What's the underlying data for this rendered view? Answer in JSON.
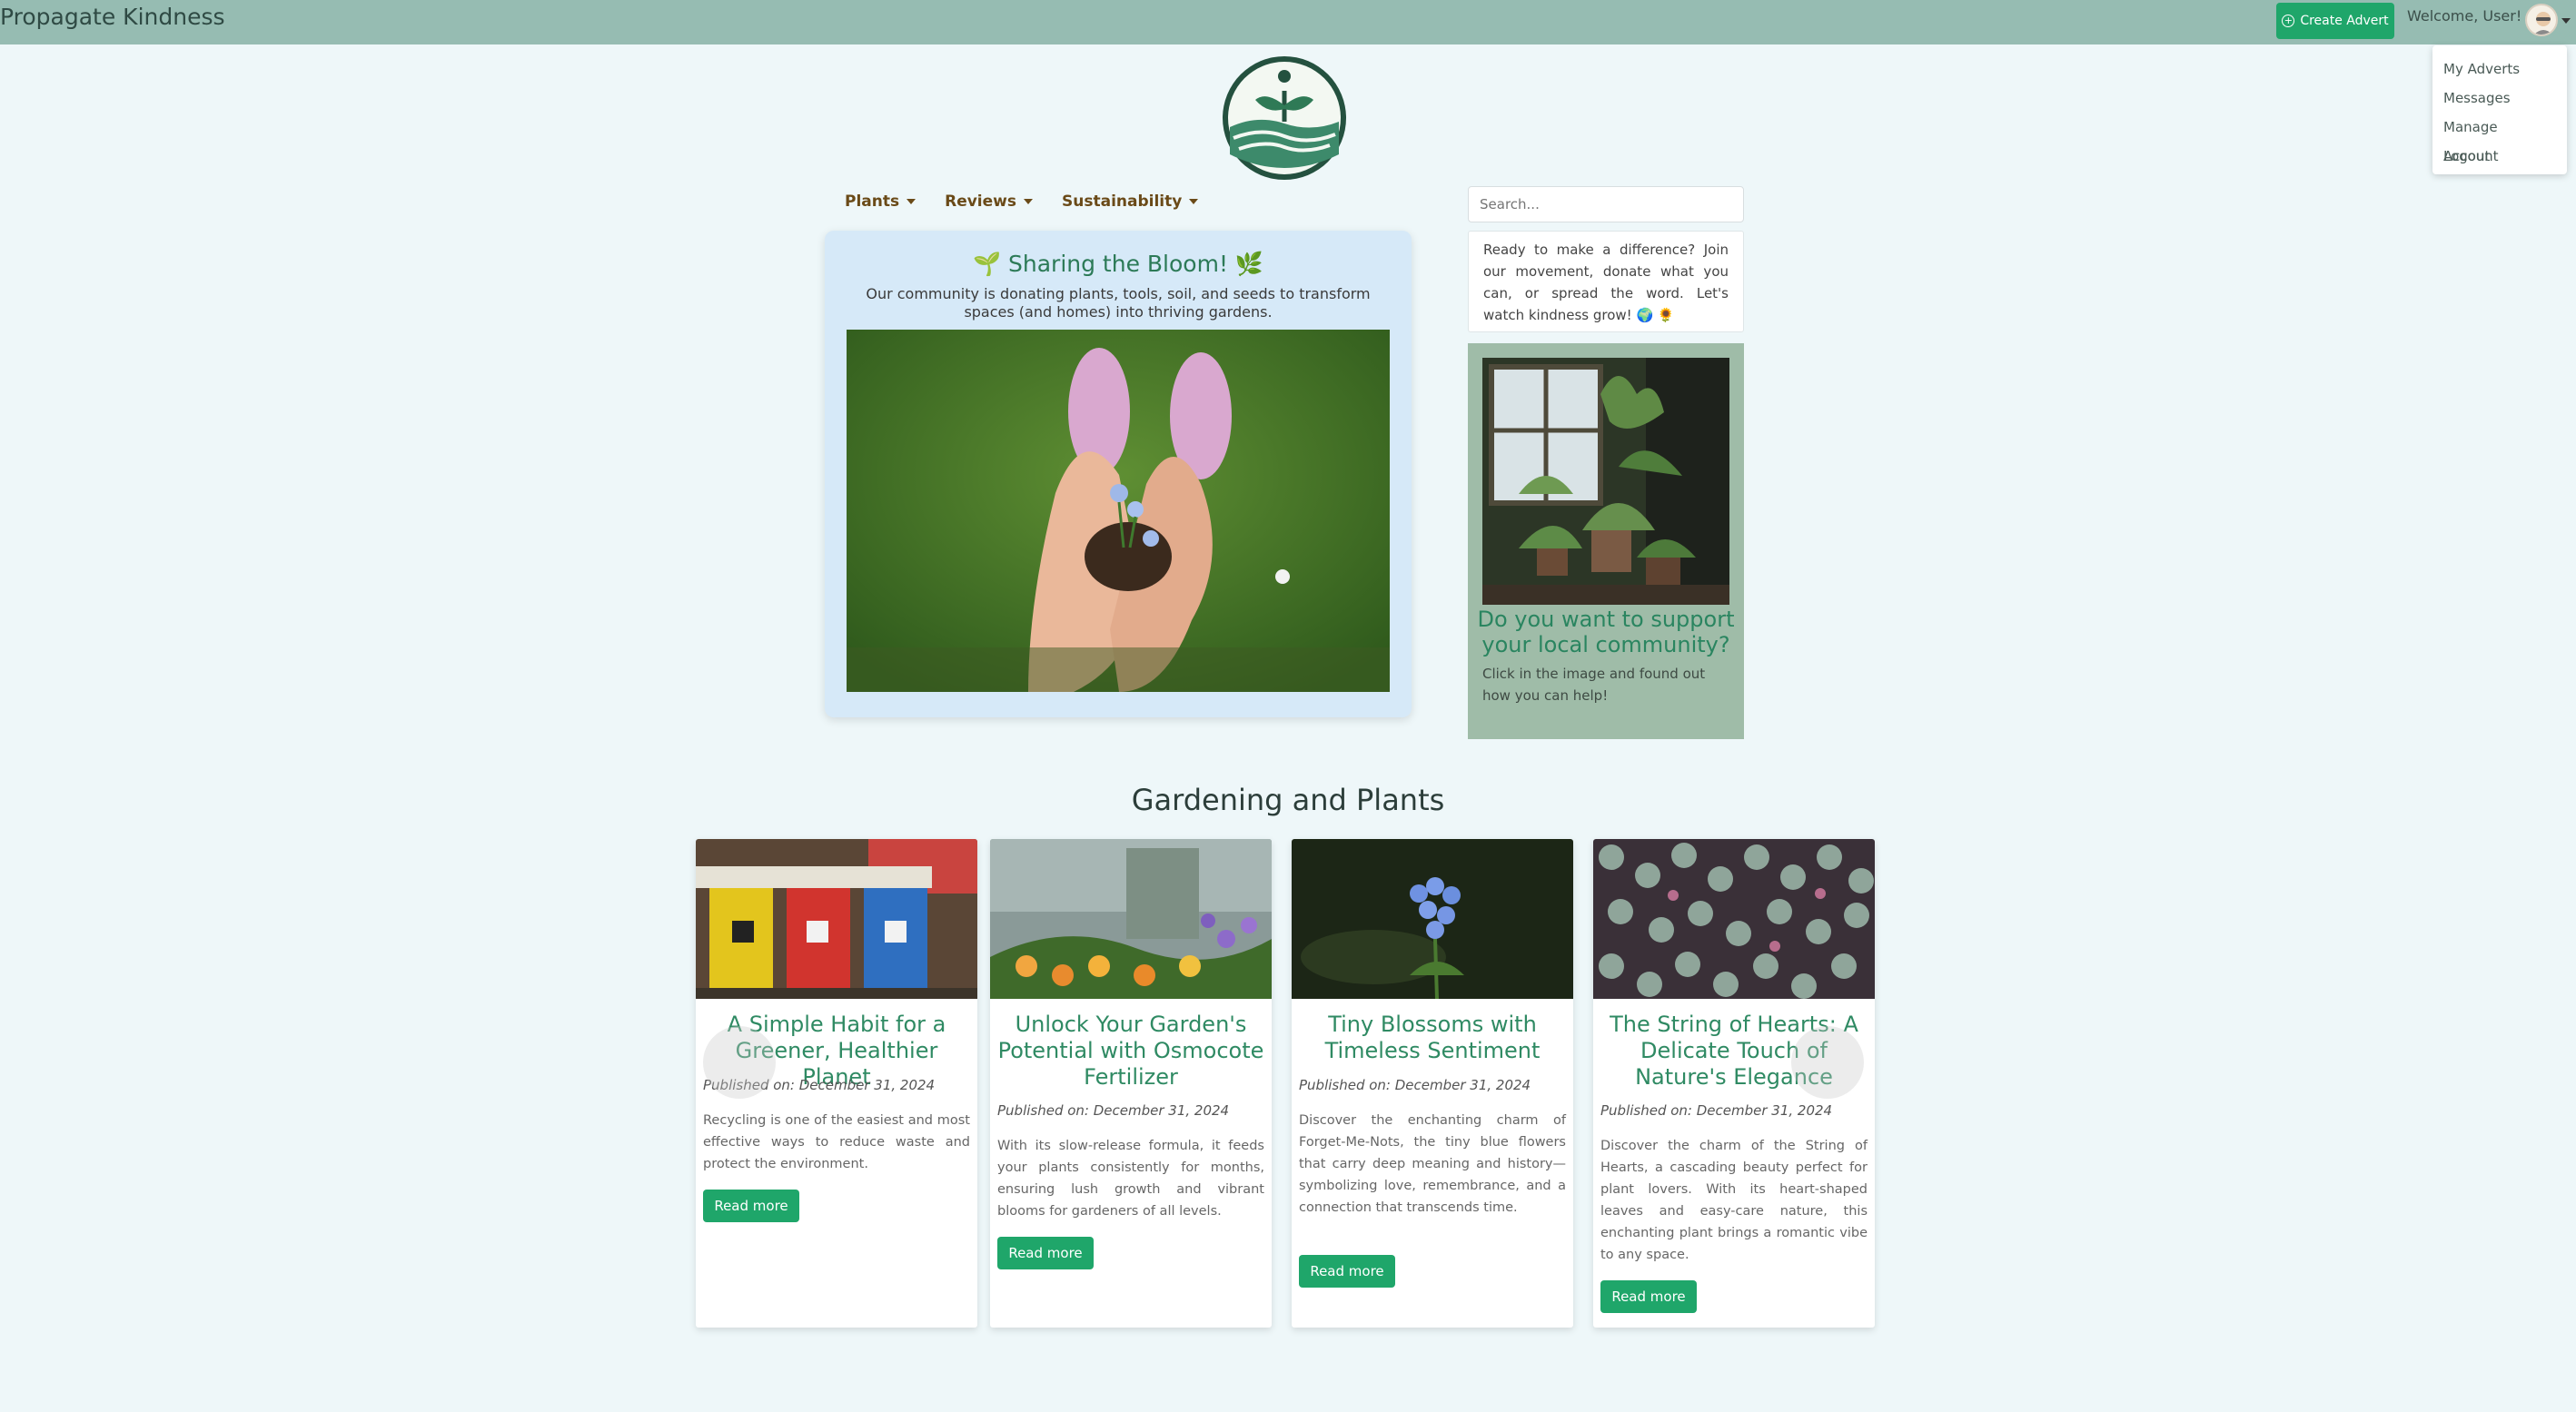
{
  "header": {
    "brand": "Propagate Kindness",
    "create_advert": "Create Advert",
    "welcome": "Welcome, User!"
  },
  "user_menu": {
    "items": [
      {
        "label": "My Adverts"
      },
      {
        "label": "Messages"
      },
      {
        "label": "Manage Account"
      },
      {
        "label": "Logout"
      }
    ]
  },
  "nav": {
    "items": [
      {
        "label": "Plants"
      },
      {
        "label": "Reviews"
      },
      {
        "label": "Sustainability"
      }
    ]
  },
  "featured": {
    "title": "🌱 Sharing the Bloom! 🌿",
    "text": "Our community is donating plants, tools, soil, and seeds to transform spaces (and homes) into thriving gardens."
  },
  "search": {
    "placeholder": "Search..."
  },
  "sidebar": {
    "join_text": "Ready to make a difference? Join our movement, donate what you can, or spread the word. Let's watch kindness grow! 🌍 🌻",
    "support_title": "Do you want to support your local community?",
    "support_text": "Click in the image and found out how you can help!"
  },
  "section": {
    "title": "Gardening and Plants"
  },
  "cards": [
    {
      "title": "A Simple Habit for a Greener, Healthier Planet",
      "date": "Published on: December 31, 2024",
      "text": "Recycling is one of the easiest and most effective ways to reduce waste and protect the environment.",
      "button": "Read more"
    },
    {
      "title": "Unlock Your Garden's Potential with Osmocote Fertilizer",
      "date": "Published on: December 31, 2024",
      "text": "With its slow-release formula, it feeds your plants consistently for months, ensuring lush growth and vibrant blooms for gardeners of all levels.",
      "button": "Read more"
    },
    {
      "title": "Tiny Blossoms with Timeless Sentiment",
      "date": "Published on: December 31, 2024",
      "text": "Discover the enchanting charm of Forget-Me-Nots, the tiny blue flowers that carry deep meaning and history—symbolizing love, remembrance, and a connection that transcends time.",
      "button": "Read more"
    },
    {
      "title": "The String of Hearts: A Delicate Touch of Nature's Elegance",
      "date": "Published on: December 31, 2024",
      "text": "Discover the charm of the String of Hearts, a cascading beauty perfect for plant lovers. With its heart-shaped leaves and easy-care nature, this enchanting plant brings a romantic vibe to any space.",
      "button": "Read more"
    }
  ],
  "colors": {
    "topbar": "#96bcb2",
    "accent_button": "#1fa66a",
    "title_green": "#2f8a63",
    "page_bg": "#eef7f9"
  }
}
